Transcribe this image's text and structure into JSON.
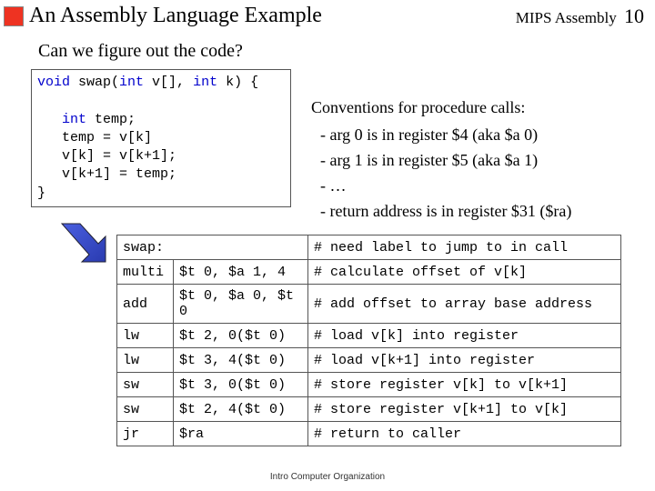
{
  "header": {
    "title": "An Assembly Language Example",
    "right_label": "MIPS Assembly",
    "page_number": "10"
  },
  "subtitle": "Can we figure out the code?",
  "c_code": {
    "l1a": "void",
    "l1b": " swap(",
    "l1c": "int",
    "l1d": " v[], ",
    "l1e": "int",
    "l1f": " k) {",
    "l2": "",
    "l3a": "   int",
    "l3b": " temp;",
    "l4": "   temp = v[k]",
    "l5": "   v[k] = v[k+1];",
    "l6": "   v[k+1] = temp;",
    "l7": "}"
  },
  "conventions": {
    "heading": "Conventions for procedure calls:",
    "b1": "-  arg 0 is in register $4 (aka $a 0)",
    "b2": "-  arg 1 is in register $5 (aka $a 1)",
    "b3": "-  …",
    "b4": "-  return address is in register $31 ($ra)"
  },
  "asm": {
    "label": "swap:",
    "label_comment": "# need label to jump to in call",
    "rows": [
      {
        "op": "multi",
        "args": "$t 0, $a 1, 4",
        "cmt": "# calculate offset of v[k]"
      },
      {
        "op": "add",
        "args": "$t 0, $a 0, $t 0",
        "cmt": "# add offset to array base address"
      },
      {
        "op": "lw",
        "args": "$t 2, 0($t 0)",
        "cmt": "# load v[k] into register"
      },
      {
        "op": "lw",
        "args": "$t 3, 4($t 0)",
        "cmt": "# load v[k+1] into register"
      },
      {
        "op": "sw",
        "args": "$t 3, 0($t 0)",
        "cmt": "# store register v[k] to v[k+1]"
      },
      {
        "op": "sw",
        "args": "$t 2, 4($t 0)",
        "cmt": "# store register v[k+1] to v[k]"
      },
      {
        "op": "jr",
        "args": "$ra",
        "cmt": "# return to caller"
      }
    ]
  },
  "footer": "Intro Computer Organization"
}
